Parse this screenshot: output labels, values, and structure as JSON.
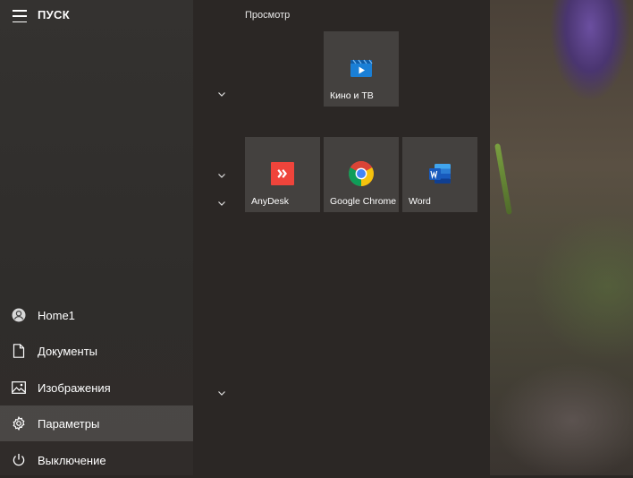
{
  "start": {
    "title": "ПУСК"
  },
  "sidebar": {
    "items": [
      {
        "label": "Home1",
        "icon": "user-icon"
      },
      {
        "label": "Документы",
        "icon": "document-icon"
      },
      {
        "label": "Изображения",
        "icon": "image-icon"
      },
      {
        "label": "Параметры",
        "icon": "gear-icon",
        "active": true
      },
      {
        "label": "Выключение",
        "icon": "power-icon"
      }
    ]
  },
  "tiles": {
    "group_label": "Просмотр",
    "items": [
      {
        "label": "Кино и ТВ",
        "icon": "movies-tv-icon",
        "color": "#1a7fd6"
      },
      {
        "label": "AnyDesk",
        "icon": "anydesk-icon",
        "color": "#ef443b"
      },
      {
        "label": "Google Chrome",
        "icon": "chrome-icon"
      },
      {
        "label": "Word",
        "icon": "word-icon",
        "color": "#2b5797"
      }
    ]
  }
}
